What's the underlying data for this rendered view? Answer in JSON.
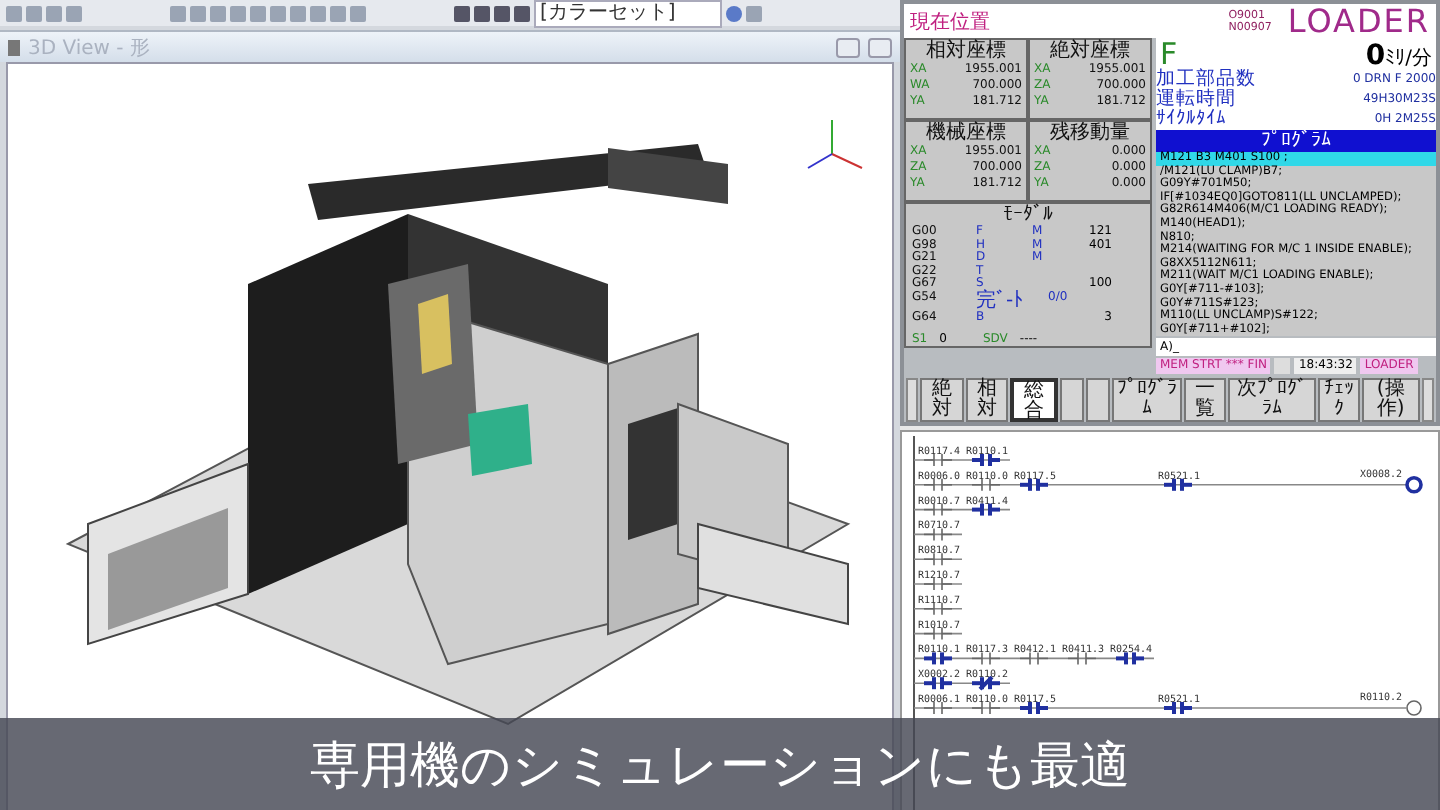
{
  "toolbar": {
    "color_set": "[カラーセット]"
  },
  "view_window": {
    "title": "3D View - 形"
  },
  "cnc": {
    "title": "現在位置",
    "program_no": "O9001",
    "block_no": "N00907",
    "mode": "LOADER",
    "coords": [
      {
        "title": "相対座標",
        "rows": [
          [
            "XA",
            "1955.001"
          ],
          [
            "WA",
            "700.000"
          ],
          [
            "YA",
            "181.712"
          ]
        ]
      },
      {
        "title": "絶対座標",
        "rows": [
          [
            "XA",
            "1955.001"
          ],
          [
            "ZA",
            "700.000"
          ],
          [
            "YA",
            "181.712"
          ]
        ]
      },
      {
        "title": "機械座標",
        "rows": [
          [
            "XA",
            "1955.001"
          ],
          [
            "ZA",
            "700.000"
          ],
          [
            "YA",
            "181.712"
          ]
        ]
      },
      {
        "title": "残移動量",
        "rows": [
          [
            "XA",
            "0.000"
          ],
          [
            "ZA",
            "0.000"
          ],
          [
            "YA",
            "0.000"
          ]
        ]
      }
    ],
    "feed": {
      "label": "F",
      "value": "0",
      "unit": "ﾐﾘ/分"
    },
    "info": [
      {
        "label": "加工部品数",
        "value": "0  DRN F   2000"
      },
      {
        "label": "運転時間",
        "value": "49H30M23S"
      },
      {
        "label": "ｻｲｸﾙﾀｲﾑ",
        "value": "0H 2M25S"
      }
    ],
    "program_title": "ﾌﾟﾛｸﾞﾗﾑ",
    "program_lines": [
      {
        "text": "M121 B3 M401 S100 ;",
        "selected": true
      },
      {
        "text": "/M121(LU CLAMP)B7;",
        "selected": false
      },
      {
        "text": "G09Y#701M50;",
        "selected": false
      },
      {
        "text": "IF[#1034EQ0]GOTO811(LL UNCLAMPED);",
        "selected": false
      },
      {
        "text": "G82R614M406(M/C1 LOADING READY);",
        "selected": false
      },
      {
        "text": "M140(HEAD1);",
        "selected": false
      },
      {
        "text": "N810;",
        "selected": false
      },
      {
        "text": "M214(WAITING FOR M/C 1 INSIDE ENABLE);",
        "selected": false
      },
      {
        "text": "G8XX5112N611;",
        "selected": false
      },
      {
        "text": "M211(WAIT M/C1 LOADING ENABLE);",
        "selected": false
      },
      {
        "text": "G0Y[#711-#103];",
        "selected": false
      },
      {
        "text": "G0Y#711S#123;",
        "selected": false
      },
      {
        "text": "M110(LL UNCLAMP)S#122;",
        "selected": false
      },
      {
        "text": "G0Y[#711+#102];",
        "selected": false
      }
    ],
    "modal_title": "ﾓｰﾀﾞﾙ",
    "modal_rows": [
      [
        "G00",
        "F",
        "M",
        "121"
      ],
      [
        "G98",
        "H",
        "M",
        "401"
      ],
      [
        "G21",
        "D",
        "M",
        ""
      ],
      [
        "G22",
        "T",
        "",
        ""
      ],
      [
        "G67",
        "S",
        "",
        "100"
      ],
      [
        "G54",
        "完ﾞ-ﾄ",
        "0/0",
        ""
      ],
      [
        "G64",
        "B",
        "",
        "3"
      ]
    ],
    "spindle": [
      [
        "S1",
        "0"
      ],
      [
        "SDV",
        "----"
      ]
    ],
    "input": "A)_",
    "status": {
      "mode": "MEM STRT *** FIN",
      "time": "18:43:32",
      "name": "LOADER"
    },
    "softkeys": [
      {
        "label": "絶対",
        "selected": false
      },
      {
        "label": "相対",
        "selected": false
      },
      {
        "label": "総合",
        "selected": true
      },
      {
        "selected": false
      },
      {
        "selected": false
      },
      {
        "label": "ﾌﾟﾛｸﾞﾗﾑ",
        "selected": false
      },
      {
        "label": "一覧",
        "selected": false
      },
      {
        "label": "次ﾌﾟﾛｸﾞﾗﾑ",
        "selected": false
      },
      {
        "label": "ﾁｪｯｸ",
        "selected": false
      },
      {
        "label": "(操作)",
        "selected": false
      }
    ]
  },
  "ladder": {
    "rows": [
      {
        "contacts": [
          {
            "label": "R0117.4",
            "kind": "no",
            "active": false
          },
          {
            "label": "R0110.1",
            "kind": "no",
            "active": true
          }
        ]
      },
      {
        "contacts": [
          {
            "label": "R0006.0",
            "kind": "no",
            "active": false
          },
          {
            "label": "R0110.0",
            "kind": "no",
            "active": false
          },
          {
            "label": "R0117.5",
            "kind": "no",
            "active": true
          },
          {
            "kind": "wire"
          },
          {
            "kind": "wire"
          },
          {
            "label": "R0521.1",
            "kind": "no",
            "active": true
          }
        ],
        "coil": {
          "label": "X0008.2",
          "active": true
        }
      },
      {
        "contacts": [
          {
            "label": "R0010.7",
            "kind": "no",
            "active": false
          },
          {
            "label": "R0411.4",
            "kind": "no",
            "active": true
          }
        ]
      },
      {
        "contacts": [
          {
            "label": "R0710.7",
            "kind": "no",
            "active": false
          }
        ]
      },
      {
        "contacts": [
          {
            "label": "R0810.7",
            "kind": "no",
            "active": false
          }
        ]
      },
      {
        "contacts": [
          {
            "label": "R1210.7",
            "kind": "no",
            "active": false
          }
        ]
      },
      {
        "contacts": [
          {
            "label": "R1110.7",
            "kind": "no",
            "active": false
          }
        ]
      },
      {
        "contacts": [
          {
            "label": "R1010.7",
            "kind": "no",
            "active": false
          }
        ]
      },
      {
        "contacts": [
          {
            "label": "R0110.1",
            "kind": "no",
            "active": true
          },
          {
            "label": "R0117.3",
            "kind": "no",
            "active": false
          },
          {
            "label": "R0412.1",
            "kind": "no",
            "active": false
          },
          {
            "label": "R0411.3",
            "kind": "no",
            "active": false
          },
          {
            "label": "R0254.4",
            "kind": "no",
            "active": true
          }
        ]
      },
      {
        "contacts": [
          {
            "label": "X0002.2",
            "kind": "no",
            "active": true
          },
          {
            "label": "R0110.2",
            "kind": "nc",
            "active": true
          }
        ]
      },
      {
        "contacts": [
          {
            "label": "R0006.1",
            "kind": "no",
            "active": false
          },
          {
            "label": "R0110.0",
            "kind": "no",
            "active": false
          },
          {
            "label": "R0117.5",
            "kind": "no",
            "active": true
          },
          {
            "kind": "wire"
          },
          {
            "kind": "wire"
          },
          {
            "label": "R0521.1",
            "kind": "no",
            "active": true
          }
        ],
        "coil": {
          "label": "R0110.2",
          "active": false
        }
      }
    ]
  },
  "caption": "専用機のシミュレーションにも最適"
}
